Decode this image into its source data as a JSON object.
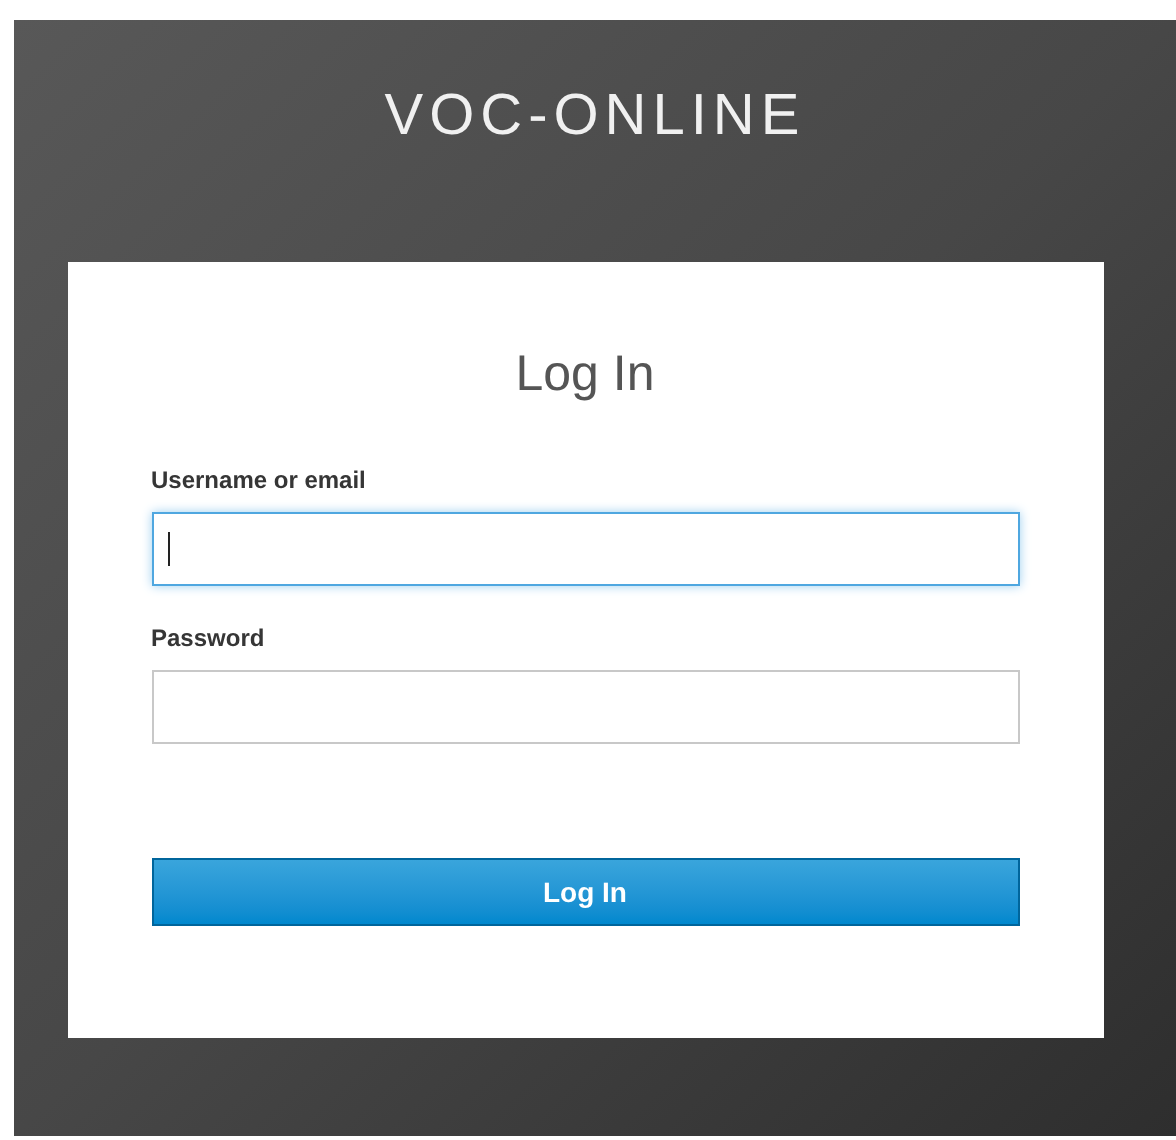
{
  "header": {
    "title": "VOC-ONLINE"
  },
  "form": {
    "title": "Log In",
    "fields": [
      {
        "label": "Username or email",
        "focused": true
      },
      {
        "label": "Password",
        "focused": false
      }
    ],
    "submit": "Log In"
  }
}
